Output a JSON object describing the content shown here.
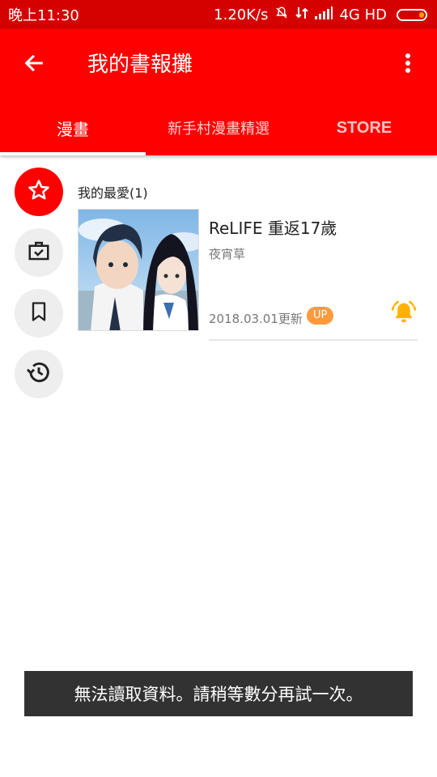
{
  "status_bar": {
    "time": "晚上11:30",
    "network_speed": "1.20K/s",
    "network_type": "4G HD",
    "icons": [
      "mute-bell-icon",
      "data-arrows-icon",
      "signal-icon",
      "battery-icon"
    ]
  },
  "app_bar": {
    "title": "我的書報攤",
    "back_icon": "arrow-left-icon",
    "menu_icon": "more-vert-icon",
    "color": "#ff0000"
  },
  "tabs": [
    {
      "label": "漫畫",
      "active": true
    },
    {
      "label": "新手村漫畫精選",
      "active": false
    },
    {
      "label": "STORE",
      "active": false
    }
  ],
  "side_nav": [
    {
      "icon": "star-icon",
      "active": true
    },
    {
      "icon": "briefcase-check-icon",
      "active": false
    },
    {
      "icon": "bookmark-icon",
      "active": false
    },
    {
      "icon": "history-icon",
      "active": false
    }
  ],
  "favorites": {
    "section_title": "我的最愛(1)",
    "items": [
      {
        "title": "ReLIFE 重返17歲",
        "author": "夜宵草",
        "updated": "2018.03.01更新",
        "badge": "UP",
        "bell_icon": "notification-bell-icon"
      }
    ]
  },
  "toast": {
    "message": "無法讀取資料。請稍等數分再試一次。"
  }
}
